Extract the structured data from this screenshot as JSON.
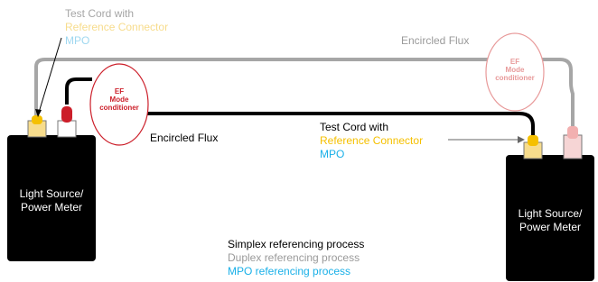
{
  "colors": {
    "black": "#000000",
    "gray": "#9a9a9a",
    "light_gray": "#b0b0b0",
    "yellow": "#f5c000",
    "pale_yellow": "#f7dc8c",
    "cyan": "#1ab0e8",
    "pale_cyan": "#9fd8f0",
    "red": "#cc1f2a",
    "pink": "#e89a9a"
  },
  "left_device": {
    "label_line1": "Light Source/",
    "label_line2": "Power Meter"
  },
  "right_device": {
    "label_line1": "Light Source/",
    "label_line2": "Power Meter"
  },
  "top_left_label": {
    "line1": "Test Cord with",
    "line2": "Reference Connector",
    "line3": "MPO"
  },
  "mid_label": {
    "line1": "Test Cord with",
    "line2": "Reference Connector",
    "line3": "MPO"
  },
  "ef_left": {
    "line1": "EF",
    "line2": "Mode",
    "line3": "conditioner"
  },
  "ef_right": {
    "line1": "EF",
    "line2": "Mode",
    "line3": "conditioner"
  },
  "encircled_flux_top": "Encircled Flux",
  "encircled_flux_mid": "Encircled Flux",
  "legend": {
    "simplex": "Simplex referencing process",
    "duplex": "Duplex referencing process",
    "mpo": "MPO referencing process"
  }
}
